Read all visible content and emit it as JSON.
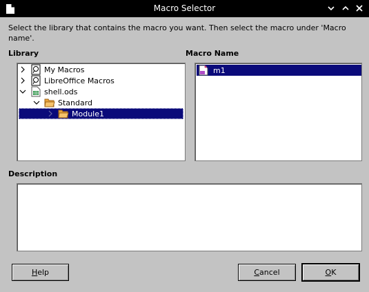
{
  "window": {
    "title": "Macro Selector"
  },
  "instructions": "Select the library that contains the macro you want. Then select the macro under 'Macro name'.",
  "library": {
    "label": "Library",
    "items": [
      {
        "label": "My Macros",
        "expander": "collapsed",
        "icon": "basic-library-icon"
      },
      {
        "label": "LibreOffice Macros",
        "expander": "collapsed",
        "icon": "basic-library-icon"
      },
      {
        "label": "shell.ods",
        "expander": "expanded",
        "icon": "spreadsheet-document-icon"
      },
      {
        "label": "Standard",
        "expander": "expanded",
        "icon": "open-folder-icon"
      },
      {
        "label": "Module1",
        "expander": "collapsed",
        "icon": "open-folder-icon",
        "selected": true
      }
    ]
  },
  "macro_name": {
    "label": "Macro Name",
    "items": [
      {
        "label": "m1",
        "icon": "macro-icon",
        "selected": true
      }
    ]
  },
  "description": {
    "label": "Description",
    "text": ""
  },
  "buttons": {
    "help": {
      "mnemonic": "H",
      "rest": "elp"
    },
    "cancel": {
      "mnemonic": "C",
      "rest": "ancel"
    },
    "ok": {
      "mnemonic": "O",
      "rest": "K"
    }
  },
  "colors": {
    "selection": "#0a0a7a",
    "dialog_bg": "#c3c3c3",
    "titlebar_bg": "#000000"
  }
}
